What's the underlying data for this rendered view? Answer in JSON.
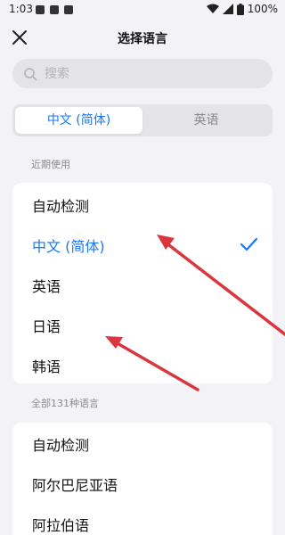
{
  "status_bar": {
    "time": "1:03",
    "battery": "100%"
  },
  "header": {
    "title": "选择语言",
    "close_icon": "close-icon"
  },
  "search": {
    "placeholder": "搜索",
    "value": ""
  },
  "segmented": {
    "options": [
      "中文 (简体)",
      "英语"
    ],
    "selected": "中文 (简体)"
  },
  "recent": {
    "label": "近期使用",
    "items": [
      {
        "label": "自动检测",
        "selected": false
      },
      {
        "label": "中文 (简体)",
        "selected": true
      },
      {
        "label": "英语",
        "selected": false
      },
      {
        "label": "日语",
        "selected": false
      },
      {
        "label": "韩语",
        "selected": false
      }
    ]
  },
  "all": {
    "label": "全部131种语言",
    "items": [
      {
        "label": "自动检测"
      },
      {
        "label": "阿尔巴尼亚语"
      },
      {
        "label": "阿拉伯语"
      }
    ]
  },
  "colors": {
    "accent": "#1677ff",
    "annotation": "#d9363e",
    "background": "#f2f2f7"
  }
}
